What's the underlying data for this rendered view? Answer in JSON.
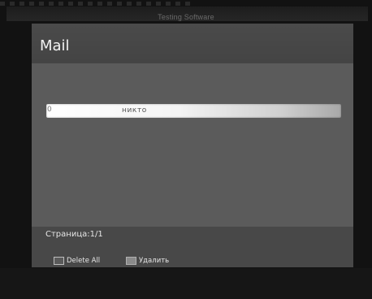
{
  "app": {
    "header_title": "Testing Software"
  },
  "panel": {
    "title": "Mail"
  },
  "mail_list": {
    "items": [
      {
        "index": "0",
        "text": "никто"
      }
    ]
  },
  "footer": {
    "page_indicator": "Страница:1/1",
    "legends": [
      {
        "label": "Delete All",
        "icon": "blank-key-icon"
      },
      {
        "label": "Удалить",
        "icon": "grey-key-icon"
      }
    ]
  },
  "colors": {
    "background": "#121212",
    "panel": "#5b5b5b",
    "panel_header": "#474747",
    "text": "#e6e6e6",
    "selection": "#ffffff"
  }
}
